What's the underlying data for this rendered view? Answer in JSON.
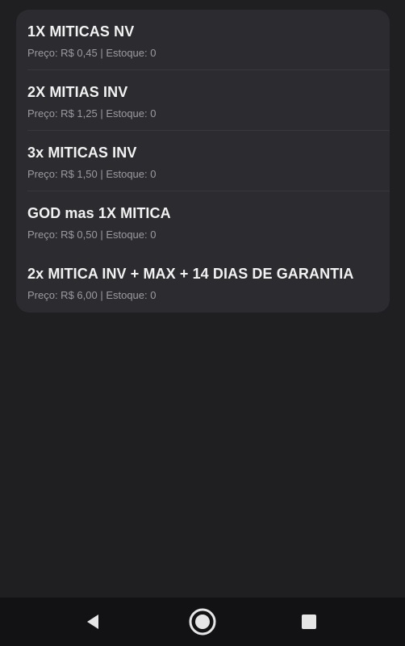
{
  "products": [
    {
      "title": "1X MITICAS NV",
      "info": "Preço: R$ 0,45 | Estoque: 0"
    },
    {
      "title": "2X MITIAS INV",
      "info": "Preço: R$ 1,25 | Estoque: 0"
    },
    {
      "title": "3x MITICAS INV",
      "info": "Preço: R$ 1,50 | Estoque: 0"
    },
    {
      "title": "GOD mas 1X MITICA",
      "info": "Preço: R$ 0,50 | Estoque: 0"
    },
    {
      "title": "2x MITICA INV + MAX + 14 DIAS DE GARANTIA",
      "info": "Preço: R$ 6,00 | Estoque: 0"
    }
  ],
  "navigation": {
    "back_icon": "triangle-back-icon",
    "home_icon": "circle-home-icon",
    "recents_icon": "square-recents-icon"
  },
  "colors": {
    "background": "#1f1f22",
    "card": "#2c2c30",
    "title_text": "#f2f2f2",
    "info_text": "#9a9aa0",
    "nav_bar": "#121214",
    "nav_icon": "#e6e6e6"
  }
}
